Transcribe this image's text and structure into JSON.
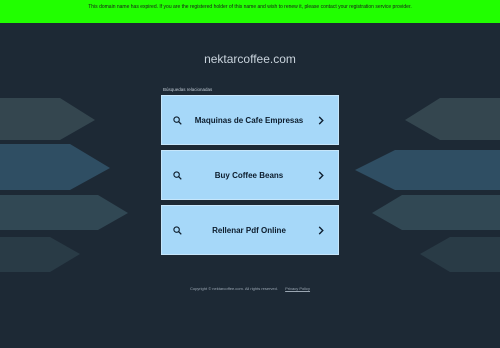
{
  "banner": {
    "text": "This domain name has expired. If you are the registered holder of this name and wish to renew it, please contact your registration service provider."
  },
  "header": {
    "domain": "nektarcoffee.com"
  },
  "related": {
    "label": "Búsquedas relacionadas",
    "items": [
      {
        "label": "Maquinas de Cafe Empresas",
        "icon": "search-icon",
        "arrow": "chevron-right-icon"
      },
      {
        "label": "Buy Coffee Beans",
        "icon": "search-icon",
        "arrow": "chevron-right-icon"
      },
      {
        "label": "Rellenar Pdf Online",
        "icon": "search-icon",
        "arrow": "chevron-right-icon"
      }
    ]
  },
  "footer": {
    "copyright": "Copyright © nektarcoffee.com.  All rights reserved.",
    "privacy": "Privacy Policy"
  },
  "colors": {
    "background": "#1d2935",
    "banner": "#21ff00",
    "result_bg": "#a6d8f9"
  }
}
